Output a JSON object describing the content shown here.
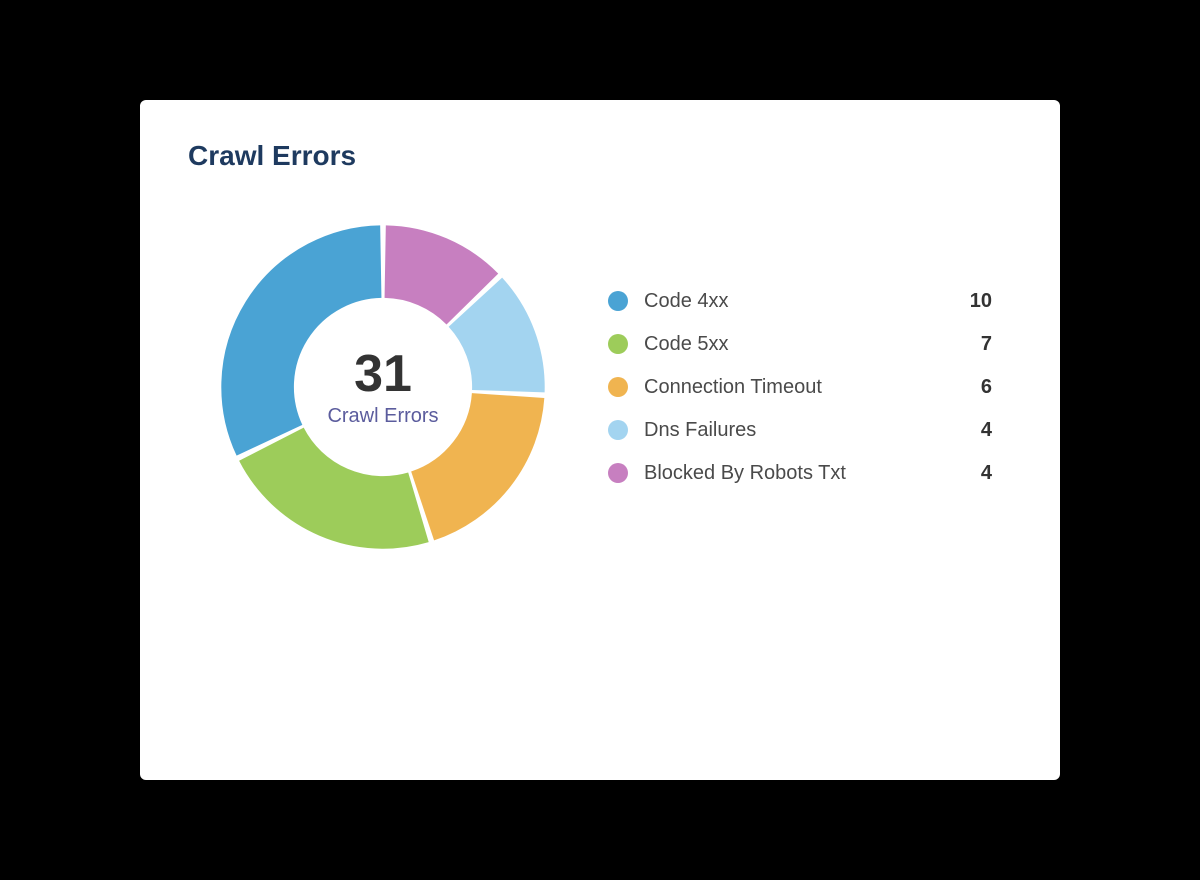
{
  "card": {
    "title": "Crawl Errors",
    "center_total": "31",
    "center_label": "Crawl Errors"
  },
  "chart_data": {
    "type": "pie",
    "title": "Crawl Errors",
    "series": [
      {
        "name": "Code 4xx",
        "value": 10,
        "color": "#4aa3d4"
      },
      {
        "name": "Code 5xx",
        "value": 7,
        "color": "#9dcc5a"
      },
      {
        "name": "Connection Timeout",
        "value": 6,
        "color": "#f0b450"
      },
      {
        "name": "Dns Failures",
        "value": 4,
        "color": "#a3d4f0"
      },
      {
        "name": "Blocked By Robots Txt",
        "value": 4,
        "color": "#c77fc0"
      }
    ],
    "total": 31
  }
}
